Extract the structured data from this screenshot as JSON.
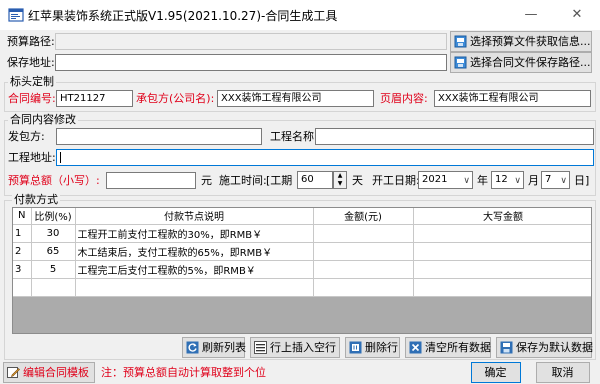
{
  "window": {
    "title": "红苹果装饰系统正式版V1.95(2021.10.27)-合同生成工具",
    "minimize": "—",
    "maximize": "☐",
    "close": "✕"
  },
  "paths": {
    "budget_label": "预算路径:",
    "budget_value": "",
    "budget_button": "选择预算文件获取信息...",
    "save_label": "保存地址:",
    "save_value": "",
    "save_button": "选择合同文件保存路径..."
  },
  "header_group": {
    "legend": "标头定制",
    "contract_no_label": "合同编号:",
    "contract_no": "HT21127",
    "contractor_label": "承包方(公司名):",
    "contractor": "XXX装饰工程有限公司",
    "page_header_label": "页眉内容:",
    "page_header": "XXX装饰工程有限公司"
  },
  "content_group": {
    "legend": "合同内容修改",
    "client_label": "发包方:",
    "client": "",
    "project_name_label": "工程名称:",
    "project_name": "",
    "project_addr_label": "工程地址:",
    "project_addr": "",
    "budget_total_label": "预算总额（小写）:",
    "budget_total": "",
    "yuan": "元",
    "period_label": "施工时间:",
    "period_prefix": "[工期",
    "period_value": "60",
    "days": "天",
    "start_label": "开工日期:",
    "year": "2021",
    "year_unit": "年",
    "month": "12",
    "month_unit": "月",
    "day": "7",
    "day_unit": "日]"
  },
  "payment": {
    "legend": "付款方式",
    "columns": [
      "N",
      "比例(%)",
      "付款节点说明",
      "金额(元)",
      "大写金额"
    ],
    "rows": [
      [
        "1",
        "30",
        "工程开工前支付工程款的30%，即RMB￥",
        "",
        ""
      ],
      [
        "2",
        "65",
        "木工结束后，支付工程款的65%，即RMB￥",
        "",
        ""
      ],
      [
        "3",
        "5",
        "工程完工后支付工程款的5%，即RMB￥",
        "",
        ""
      ]
    ],
    "buttons": {
      "refresh": "刷新列表",
      "insert": "行上插入空行",
      "delete": "删除行",
      "clear": "清空所有数据",
      "save_default": "保存为默认数据"
    }
  },
  "footer": {
    "edit_template": "编辑合同模板",
    "note": "注：预算总额自动计算取整到个位",
    "ok": "确定",
    "cancel": "取消"
  }
}
